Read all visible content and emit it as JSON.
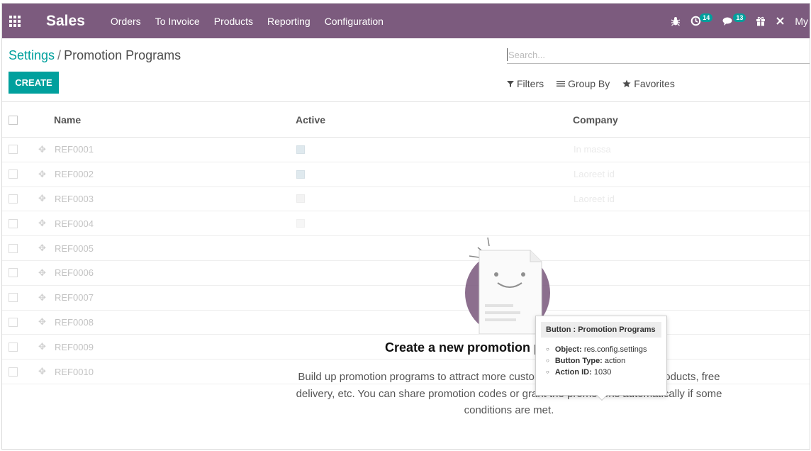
{
  "navbar": {
    "app_name": "Sales",
    "menu": [
      "Orders",
      "To Invoice",
      "Products",
      "Reporting",
      "Configuration"
    ],
    "activity_count": "14",
    "message_count": "13",
    "user_label": "My"
  },
  "breadcrumb": {
    "parent": "Settings",
    "separator": "/",
    "current": "Promotion Programs"
  },
  "toolbar": {
    "create_label": "CREATE",
    "search_placeholder": "Search...",
    "filters_label": "Filters",
    "group_by_label": "Group By",
    "favorites_label": "Favorites"
  },
  "table": {
    "headers": [
      "Name",
      "Active",
      "Company"
    ],
    "rows": [
      {
        "name": "REF0001",
        "company": "In massa"
      },
      {
        "name": "REF0002",
        "company": "Laoreet id"
      },
      {
        "name": "REF0003",
        "company": "Laoreet id"
      },
      {
        "name": "REF0004",
        "company": ""
      },
      {
        "name": "REF0005",
        "company": ""
      },
      {
        "name": "REF0006",
        "company": ""
      },
      {
        "name": "REF0007",
        "company": ""
      },
      {
        "name": "REF0008",
        "company": ""
      },
      {
        "name": "REF0009",
        "company": ""
      },
      {
        "name": "REF0010",
        "company": ""
      }
    ]
  },
  "help": {
    "title": "Create a new promotion program",
    "text": "Build up promotion programs to attract more customers with discounts, free products, free delivery, etc. You can share promotion codes or grant the promotions automatically if some conditions are met."
  },
  "tooltip": {
    "title": "Button : Promotion Programs",
    "object_label": "Object:",
    "object_value": "res.config.settings",
    "type_label": "Button Type:",
    "type_value": "action",
    "action_label": "Action ID:",
    "action_value": "1030"
  },
  "colors": {
    "navbar": "#7c5b7e",
    "accent": "#00a09d",
    "badge": "#00a09d"
  }
}
